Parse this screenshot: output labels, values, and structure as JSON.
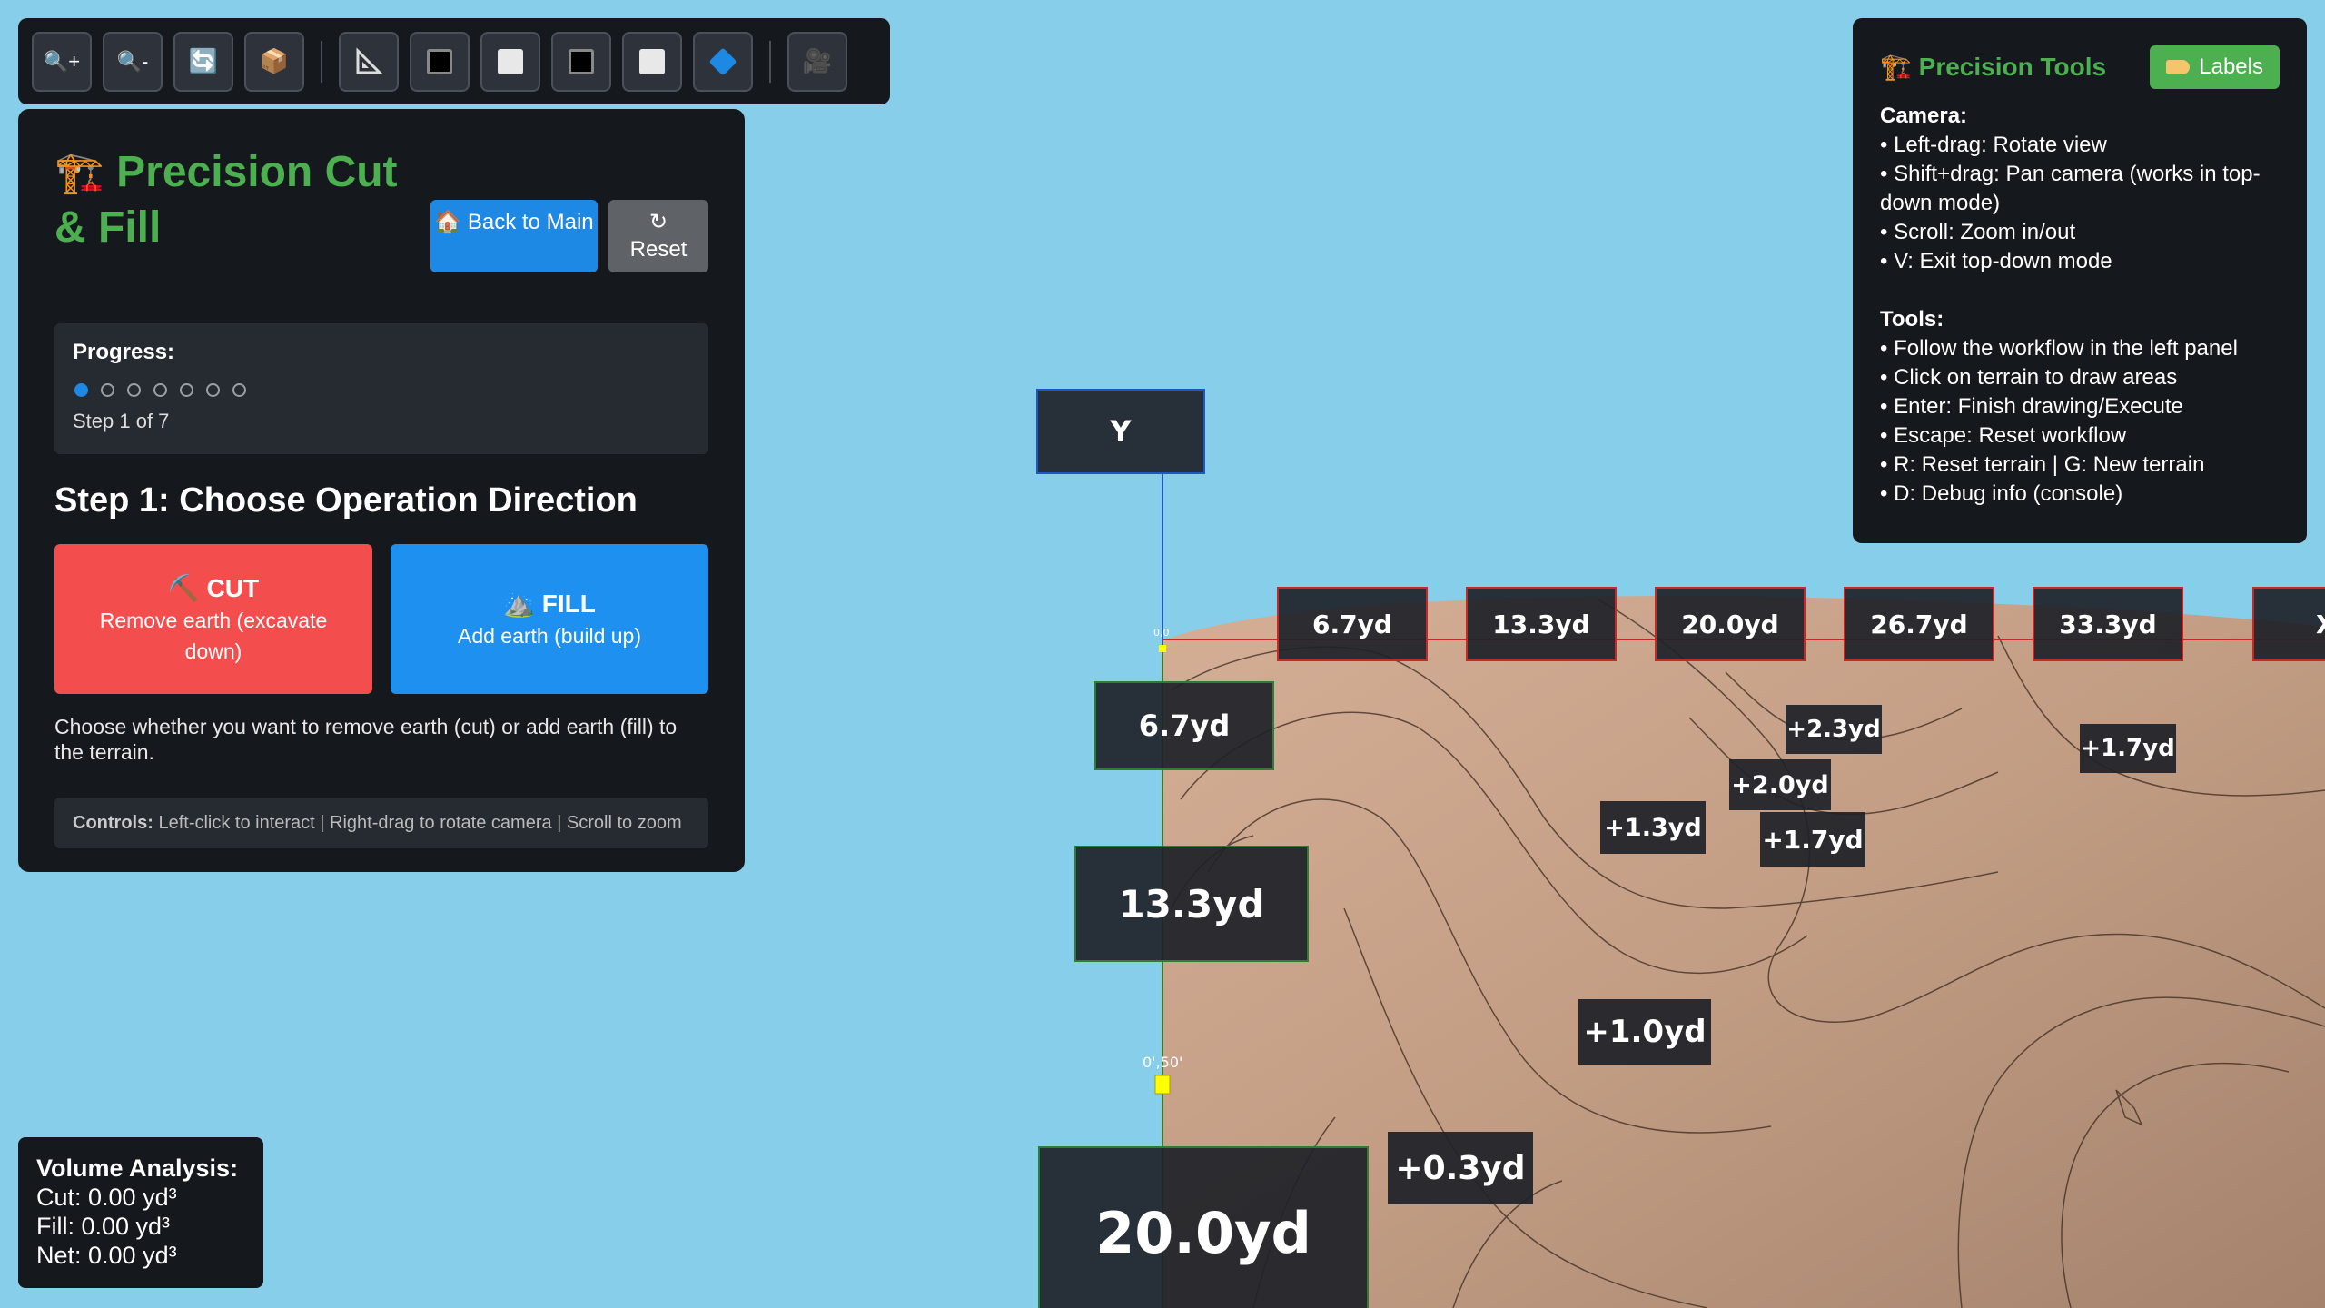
{
  "toolbar": {
    "buttons": [
      {
        "name": "zoom-in-button",
        "icon": "zoom-in-icon",
        "glyph": "🔍+"
      },
      {
        "name": "zoom-out-button",
        "icon": "zoom-out-icon",
        "glyph": "🔍-"
      },
      {
        "name": "refresh-button",
        "icon": "refresh-icon",
        "glyph": "🔄"
      },
      {
        "name": "box-button",
        "icon": "box-icon",
        "glyph": "📦"
      },
      {
        "name": "measure-button",
        "icon": "triangle-ruler-icon",
        "glyph": "📐"
      },
      {
        "name": "view-black-button",
        "icon": "black-square-icon"
      },
      {
        "name": "view-white-button",
        "icon": "white-square-icon"
      },
      {
        "name": "view-black-2-button",
        "icon": "black-square-icon"
      },
      {
        "name": "view-white-2-button",
        "icon": "white-square-icon"
      },
      {
        "name": "diamond-button",
        "icon": "blue-diamond-icon"
      },
      {
        "name": "camera-button",
        "icon": "camera-icon",
        "glyph": "🎥"
      }
    ]
  },
  "left_panel": {
    "title_icon": "🏗️",
    "title": "Precision Cut & Fill",
    "back_icon": "🏠",
    "back_label": "Back to Main",
    "reset_icon": "↻",
    "reset_label": "Reset",
    "progress_label": "Progress:",
    "progress": {
      "current": 1,
      "total": 7
    },
    "step_text": "Step 1 of 7",
    "step_title": "Step 1: Choose Operation Direction",
    "cut": {
      "icon": "⛏️",
      "name": "CUT",
      "desc": "Remove earth (excavate down)",
      "color": "#f44d4d"
    },
    "fill": {
      "icon": "⛰️",
      "name": "FILL",
      "desc": "Add earth (build up)",
      "color": "#1e90f0"
    },
    "description": "Choose whether you want to remove earth (cut) or add earth (fill) to the terrain.",
    "controls_label": "Controls:",
    "controls_text": "Left-click to interact | Right-drag to rotate camera | Scroll to zoom"
  },
  "volume": {
    "title": "Volume Analysis:",
    "cut": "Cut: 0.00 yd³",
    "fill": "Fill: 0.00 yd³",
    "net": "Net: 0.00 yd³"
  },
  "help": {
    "title_icon": "🏗️",
    "title": "Precision Tools",
    "labels_button": "Labels",
    "camera_heading": "Camera:",
    "camera_items": [
      "• Left-drag: Rotate view",
      "• Shift+drag: Pan camera (works in top-down mode)",
      "• Scroll: Zoom in/out",
      "• V: Exit top-down mode"
    ],
    "tools_heading": "Tools:",
    "tools_items": [
      "• Follow the workflow in the left panel",
      "• Click on terrain to draw areas",
      "• Enter: Finish drawing/Execute",
      "• Escape: Reset workflow",
      "• R: Reset terrain | G: New terrain",
      "• D: Debug info (console)"
    ]
  },
  "scene": {
    "axis_label": "Y",
    "top_ruler": [
      "6.7yd",
      "13.3yd",
      "20.0yd",
      "26.7yd",
      "33.3yd",
      "X"
    ],
    "side_ruler": [
      "6.7yd",
      "13.3yd",
      "20.0yd"
    ],
    "spot_elevations": [
      "+2.3yd",
      "+1.7yd",
      "+2.0yd",
      "+1.3yd",
      "+1.7yd",
      "+1.0yd",
      "+0.3yd"
    ],
    "origin_label": "0,0",
    "marker_label": "0',50'",
    "colors": {
      "sky": "#87ceeb",
      "terrain": "#c9a088",
      "top_ruler_border": "#c62828",
      "side_ruler_border": "#2e7d32"
    }
  }
}
